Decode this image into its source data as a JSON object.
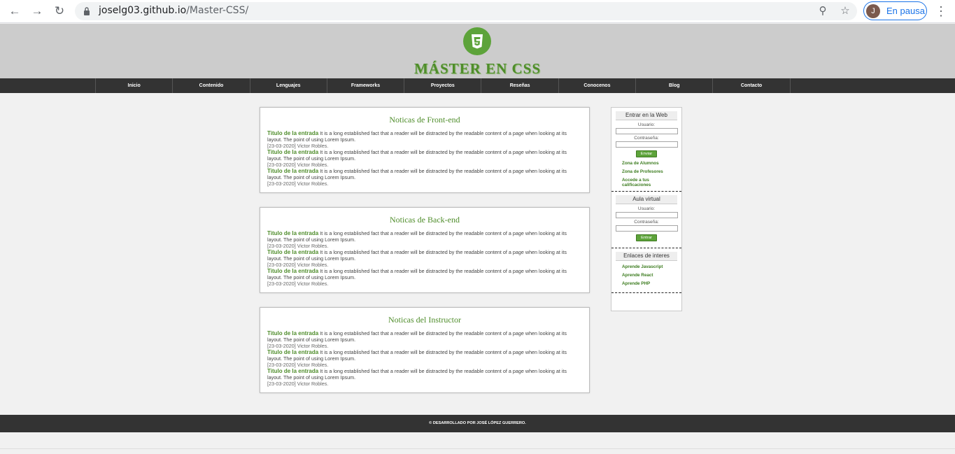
{
  "browser": {
    "url_host": "joselg03.github.io",
    "url_path": "/Master-CSS/",
    "profile_initial": "J",
    "profile_status": "En pausa"
  },
  "header": {
    "logo_glyph": "3",
    "title": "MÁSTER EN CSS"
  },
  "menu": [
    "Inicio",
    "Contenido",
    "Lenguajes",
    "Frameworks",
    "Proyectos",
    "Reseñas",
    "Conocenos",
    "Blog",
    "Contacto"
  ],
  "sections": [
    {
      "title": "Noticas de Front-end",
      "entries": [
        {
          "title": "Titulo de la entrada",
          "text": " It is a long established fact that a reader will be distracted by the readable content of a page when looking at its layout. The point of using Lorem Ipsum.",
          "meta": "[23-03-2020] Victor Robles."
        },
        {
          "title": "Titulo de la entrada",
          "text": " It is a long established fact that a reader will be distracted by the readable content of a page when looking at its layout. The point of using Lorem Ipsum.",
          "meta": "[23-03-2020] Victor Robles."
        },
        {
          "title": "Titulo de la entrada",
          "text": " It is a long established fact that a reader will be distracted by the readable content of a page when looking at its layout. The point of using Lorem Ipsum.",
          "meta": "[23-03-2020] Victor Robles."
        }
      ]
    },
    {
      "title": "Noticas de Back-end",
      "entries": [
        {
          "title": "Titulo de la entrada",
          "text": " It is a long established fact that a reader will be distracted by the readable content of a page when looking at its layout. The point of using Lorem Ipsum.",
          "meta": "[23-03-2020] Victor Robles."
        },
        {
          "title": "Titulo de la entrada",
          "text": " It is a long established fact that a reader will be distracted by the readable content of a page when looking at its layout. The point of using Lorem Ipsum.",
          "meta": "[23-03-2020] Victor Robles."
        },
        {
          "title": "Titulo de la entrada",
          "text": " It is a long established fact that a reader will be distracted by the readable content of a page when looking at its layout. The point of using Lorem Ipsum.",
          "meta": "[23-03-2020] Victor Robles."
        }
      ]
    },
    {
      "title": "Noticas del Instructor",
      "entries": [
        {
          "title": "Titulo de la entrada",
          "text": " It is a long established fact that a reader will be distracted by the readable content of a page when looking at its layout. The point of using Lorem Ipsum.",
          "meta": "[23-03-2020] Victor Robles."
        },
        {
          "title": "Titulo de la entrada",
          "text": " It is a long established fact that a reader will be distracted by the readable content of a page when looking at its layout. The point of using Lorem Ipsum.",
          "meta": "[23-03-2020] Victor Robles."
        },
        {
          "title": "Titulo de la entrada",
          "text": " It is a long established fact that a reader will be distracted by the readable content of a page when looking at its layout. The point of using Lorem Ipsum.",
          "meta": "[23-03-2020] Victor Robles."
        }
      ]
    }
  ],
  "sidebar": {
    "login": {
      "title": "Entrar en la Web",
      "user_label": "Usuario:",
      "pass_label": "Contraseña:",
      "button": "Enviar",
      "links": [
        "Zona de Alumnos",
        "Zona de Profesores",
        "Accede a tus calificaciones"
      ]
    },
    "aula": {
      "title": "Aula virtual",
      "user_label": "Usuario:",
      "pass_label": "Contraseña:",
      "button": "Entrar"
    },
    "enlaces": {
      "title": "Enlaces de interes",
      "links": [
        "Aprende Javascript",
        "Aprende React",
        "Aprende PHP"
      ]
    }
  },
  "footer": {
    "text": "© DESARROLLADO POR JOSÉ LÓPEZ GUERRERO."
  },
  "colors": {
    "brand_green": "#5da33a",
    "title_green": "#4f8d2b",
    "menu_bg": "#333333",
    "header_bg": "#cccccc"
  }
}
